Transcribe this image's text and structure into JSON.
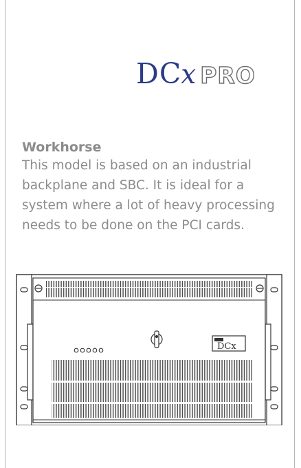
{
  "logo": {
    "dc": "DC",
    "x": "x",
    "pro": "PRO",
    "name": "dcx-pro-logo"
  },
  "product": {
    "heading": "Workhorse",
    "description": "This model is based on an industrial backplane and SBC. It is ideal for a system where a lot of heavy processing needs to be done on the PCI cards."
  },
  "image": {
    "name": "rackmount-chassis-photo",
    "badge_small": "datalink",
    "badge_main": "DCx",
    "led_count": 5,
    "icons": [
      "key-lock-icon",
      "screw-icon"
    ]
  }
}
